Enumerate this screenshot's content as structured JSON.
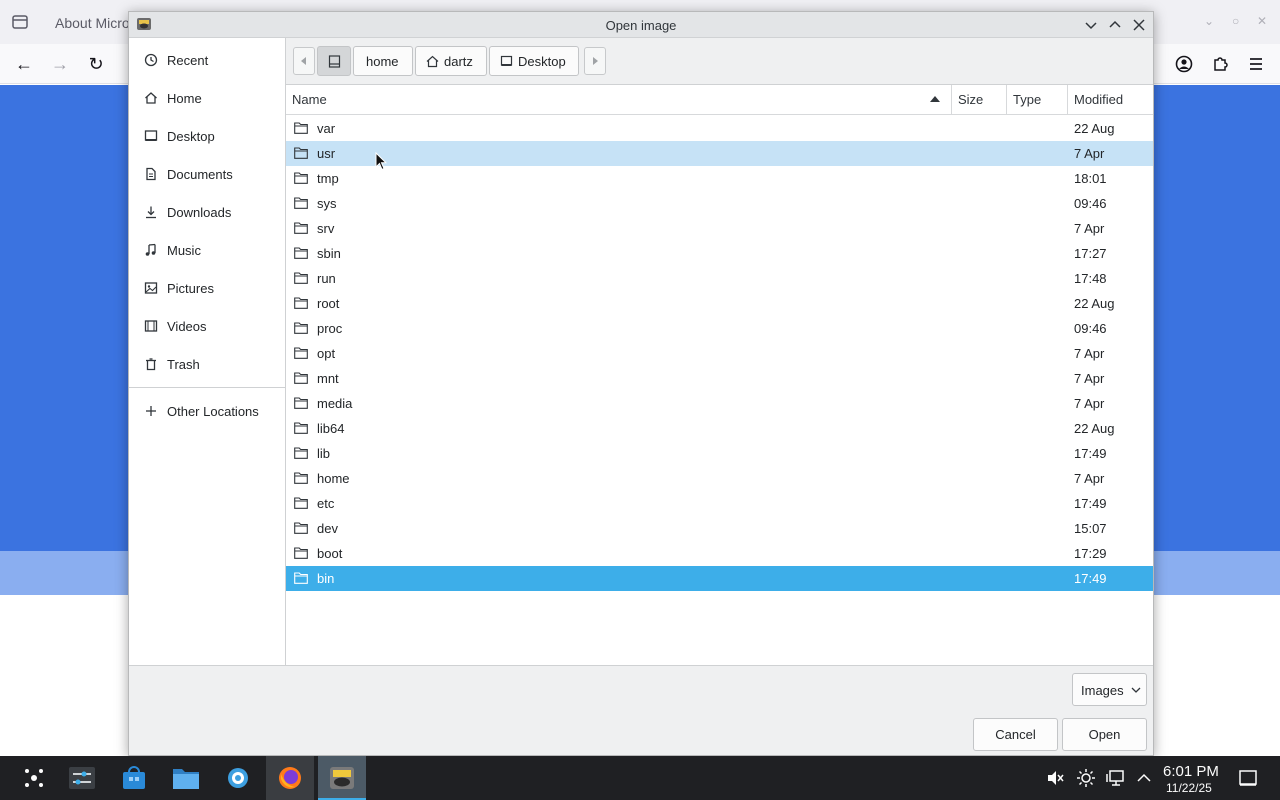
{
  "browser": {
    "tab_title": "About Micro"
  },
  "dialog": {
    "title": "Open image",
    "places": [
      {
        "label": "Recent",
        "icon": "clock-icon"
      },
      {
        "label": "Home",
        "icon": "home-icon"
      },
      {
        "label": "Desktop",
        "icon": "desktop-icon"
      },
      {
        "label": "Documents",
        "icon": "document-icon"
      },
      {
        "label": "Downloads",
        "icon": "download-icon"
      },
      {
        "label": "Music",
        "icon": "music-icon"
      },
      {
        "label": "Pictures",
        "icon": "picture-icon"
      },
      {
        "label": "Videos",
        "icon": "video-icon"
      },
      {
        "label": "Trash",
        "icon": "trash-icon"
      },
      {
        "label": "Other Locations",
        "icon": "plus-icon"
      }
    ],
    "path": [
      "home",
      "dartz",
      "Desktop"
    ],
    "columns": {
      "name": "Name",
      "size": "Size",
      "type": "Type",
      "modified": "Modified"
    },
    "files": [
      {
        "name": "var",
        "modified": "22 Aug"
      },
      {
        "name": "usr",
        "modified": "7 Apr"
      },
      {
        "name": "tmp",
        "modified": "18:01"
      },
      {
        "name": "sys",
        "modified": "09:46"
      },
      {
        "name": "srv",
        "modified": "7 Apr"
      },
      {
        "name": "sbin",
        "modified": "17:27"
      },
      {
        "name": "run",
        "modified": "17:48"
      },
      {
        "name": "root",
        "modified": "22 Aug"
      },
      {
        "name": "proc",
        "modified": "09:46"
      },
      {
        "name": "opt",
        "modified": "7 Apr"
      },
      {
        "name": "mnt",
        "modified": "7 Apr"
      },
      {
        "name": "media",
        "modified": "7 Apr"
      },
      {
        "name": "lib64",
        "modified": "22 Aug"
      },
      {
        "name": "lib",
        "modified": "17:49"
      },
      {
        "name": "home",
        "modified": "7 Apr"
      },
      {
        "name": "etc",
        "modified": "17:49"
      },
      {
        "name": "dev",
        "modified": "15:07"
      },
      {
        "name": "boot",
        "modified": "17:29"
      },
      {
        "name": "bin",
        "modified": "17:49"
      }
    ],
    "hovered_file": "usr",
    "selected_file": "bin",
    "filter": "Images",
    "cancel_label": "Cancel",
    "open_label": "Open",
    "colors": {
      "selection": "#3daee9",
      "hover": "#c6e2f6"
    }
  },
  "taskbar": {
    "clock_time": "6:01 PM",
    "clock_date": "11/22/25"
  }
}
